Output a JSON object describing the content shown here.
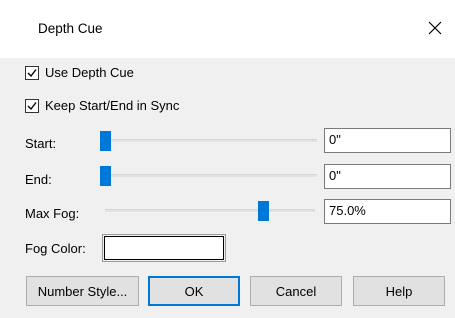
{
  "dialog": {
    "title": "Depth Cue"
  },
  "use_depth_cue": {
    "label": "Use Depth Cue",
    "checked": true
  },
  "keep_sync": {
    "label": "Keep Start/End in Sync",
    "checked": true
  },
  "start": {
    "label": "Start:",
    "value": "0\"",
    "slider_fraction": 0.0
  },
  "end": {
    "label": "End:",
    "value": "0\"",
    "slider_fraction": 0.0
  },
  "max_fog": {
    "label": "Max Fog:",
    "value": "75.0%",
    "slider_fraction": 0.75
  },
  "fog_color": {
    "label": "Fog Color:",
    "color": "#ffffff"
  },
  "buttons": {
    "number_style": "Number Style...",
    "ok": "OK",
    "cancel": "Cancel",
    "help": "Help"
  }
}
